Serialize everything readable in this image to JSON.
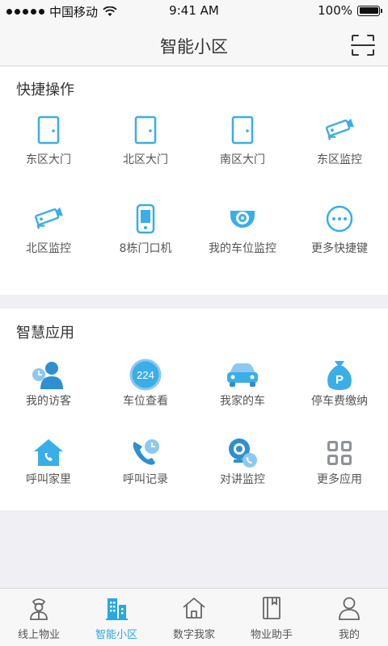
{
  "status_bar": {
    "carrier": "中国移动",
    "time": "9:41 AM",
    "battery": "100%"
  },
  "nav": {
    "title": "智能小区",
    "scan_icon": "scan-icon"
  },
  "quick_actions": {
    "title": "快捷操作",
    "items": [
      {
        "label": "东区大门",
        "icon": "door-icon"
      },
      {
        "label": "北区大门",
        "icon": "door-icon"
      },
      {
        "label": "南区大门",
        "icon": "door-icon"
      },
      {
        "label": "东区监控",
        "icon": "camera-icon"
      },
      {
        "label": "北区监控",
        "icon": "camera-icon"
      },
      {
        "label": "8栋门口机",
        "icon": "phone-device-icon"
      },
      {
        "label": "我的车位监控",
        "icon": "dome-camera-icon"
      },
      {
        "label": "更多快捷键",
        "icon": "more-icon"
      }
    ]
  },
  "smart_apps": {
    "title": "智慧应用",
    "items": [
      {
        "label": "我的访客",
        "icon": "visitor-icon"
      },
      {
        "label": "车位查看",
        "icon": "parking-count-icon",
        "badge": "224"
      },
      {
        "label": "我家的车",
        "icon": "car-icon"
      },
      {
        "label": "停车费缴纳",
        "icon": "parking-fee-icon"
      },
      {
        "label": "呼叫家里",
        "icon": "call-home-icon"
      },
      {
        "label": "呼叫记录",
        "icon": "call-log-icon"
      },
      {
        "label": "对讲监控",
        "icon": "intercom-icon"
      },
      {
        "label": "更多应用",
        "icon": "more-apps-icon"
      }
    ]
  },
  "tabs": [
    {
      "label": "线上物业",
      "icon": "property-staff-icon",
      "active": false
    },
    {
      "label": "智能小区",
      "icon": "building-icon",
      "active": true
    },
    {
      "label": "数字我家",
      "icon": "home-icon",
      "active": false
    },
    {
      "label": "物业助手",
      "icon": "book-icon",
      "active": false
    },
    {
      "label": "我的",
      "icon": "user-icon",
      "active": false
    }
  ],
  "colors": {
    "accent": "#29a7e1",
    "icon_blue": "#3aaee6",
    "gray_icon": "#8e9398"
  }
}
